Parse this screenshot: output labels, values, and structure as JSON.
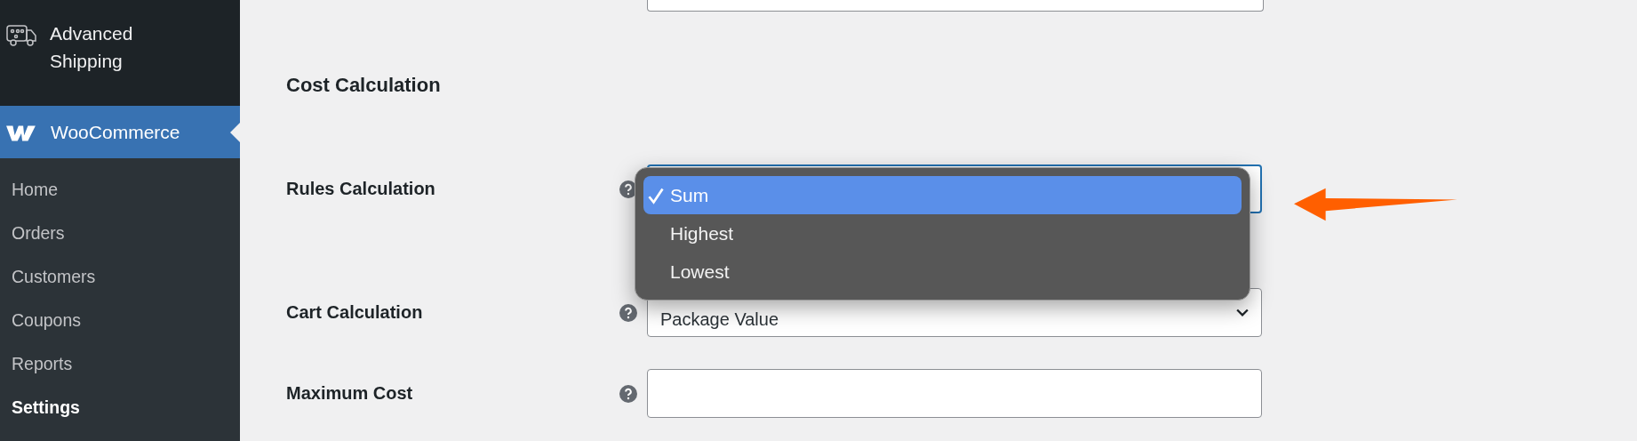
{
  "sidebar": {
    "plugin_item": {
      "label": "Advanced Shipping"
    },
    "menu": {
      "label": "WooCommerce",
      "selected": true
    },
    "submenu": [
      {
        "label": "Home",
        "selected": false
      },
      {
        "label": "Orders",
        "selected": false
      },
      {
        "label": "Customers",
        "selected": false
      },
      {
        "label": "Coupons",
        "selected": false
      },
      {
        "label": "Reports",
        "selected": false
      },
      {
        "label": "Settings",
        "selected": true
      }
    ]
  },
  "section": {
    "title": "Cost Calculation",
    "fields": [
      {
        "label": "Rules Calculation",
        "kind": "select",
        "open": true
      },
      {
        "label": "Cart Calculation",
        "kind": "select",
        "value": "Package Value",
        "open": false
      },
      {
        "label": "Maximum Cost",
        "kind": "text"
      }
    ]
  },
  "dropdown": {
    "options": [
      {
        "label": "Sum",
        "selected": true
      },
      {
        "label": "Highest",
        "selected": false
      },
      {
        "label": "Lowest",
        "selected": false
      }
    ]
  }
}
